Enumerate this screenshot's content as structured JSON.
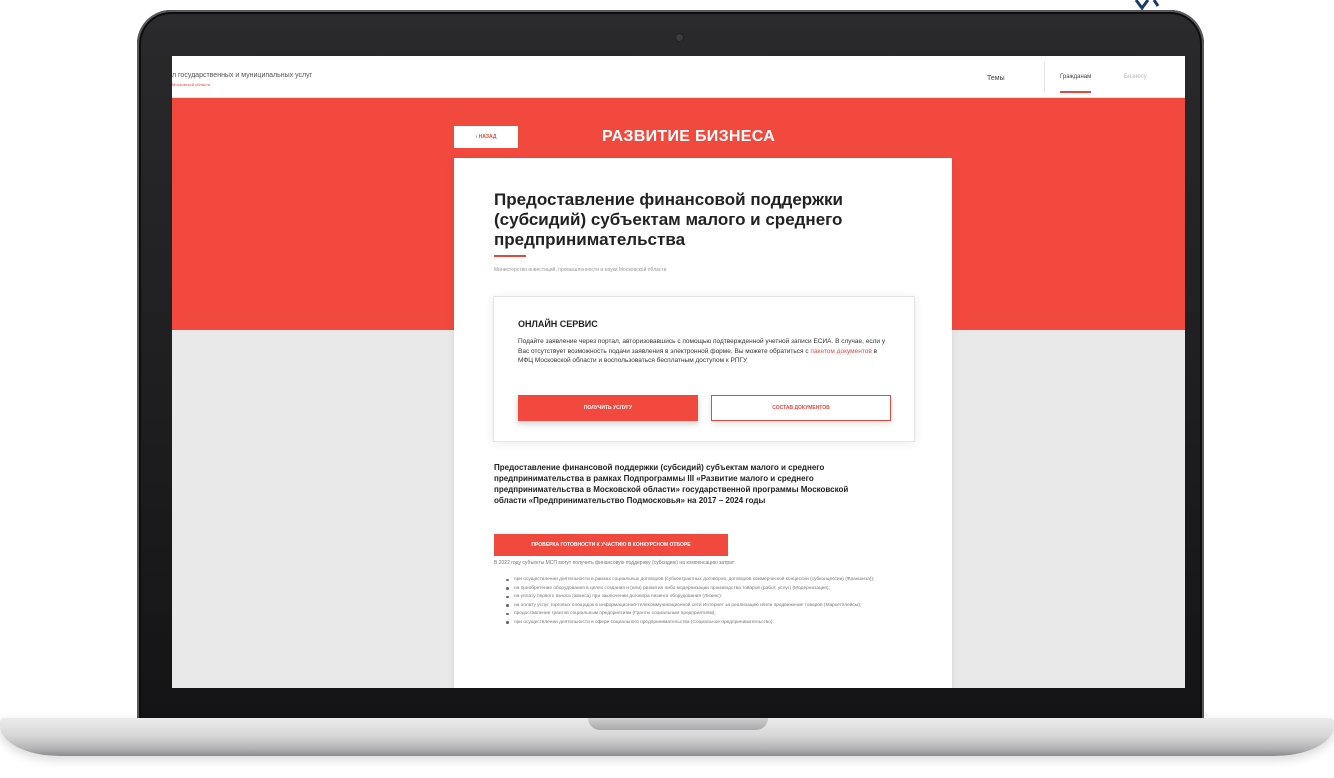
{
  "header": {
    "portal_title": "л государственных и муниципальных услуг",
    "portal_sub": "Московской области",
    "nav_topics": "Темы",
    "tab_citizens": "Гражданам",
    "tab_business": "Бизнесу"
  },
  "hero": {
    "back_label": "‹ НАЗАД",
    "title": "РАЗВИТИЕ БИЗНЕСА"
  },
  "service": {
    "title": "Предоставление финансовой поддержки (субсидий) субъектам малого и среднего предпринимательства",
    "ministry": "Министерство инвестиций, промышленности и науки Московской области"
  },
  "online": {
    "heading": "ОНЛАЙН СЕРВИС",
    "text_before": "Подайте заявление через портал, авторизовавшись с помощью подтвержденной учетной записи ЕСИА. В случае, если у Вас отсутствует возможность подачи заявления в электронной форме, Вы можете обратиться с ",
    "link": "пакетом документов",
    "text_after": " в МФЦ Московской области и воспользоваться бесплатным доступом к РПГУ",
    "get_service_label": "ПОЛУЧИТЬ УСЛУГУ",
    "docs_label": "СОСТАВ ДОКУМЕНТОВ"
  },
  "details": {
    "subprogram": "Предоставление финансовой поддержки (субсидий) субъектам малого и среднего предпринимательства в рамках Подпрограммы III «Развитие малого и среднего предпринимательства в Московской области» государственной программы Московской области «Предпринимательство Подмосковья» на 2017 – 2024 годы",
    "check_label": "ПРОВЕРКА ГОТОВНОСТИ К УЧАСТИЮ В КОНКУРСНОМ ОТБОРЕ",
    "intro": "В 2022 году субъекты МСП могут получить финансовую поддержку (субсидию) на компенсацию затрат:",
    "items": [
      "при осуществлении деятельности в рамках социальных договоров (субконтрактных договоров, договоров коммерческой концессии (субконцессии) (Франшиза));",
      "на приобретение оборудования в целях создания и (или) развития либо модернизации производства товаров (работ, услуг) (Модернизация);",
      "на уплату первого взноса (аванса) при заключении договора лизинга оборудования (Лизинг);",
      "на оплату услуг торговых площадок в информационно-телекоммуникационной сети Интернет за реализацию и/или продвижение товаров (Маркетплейсы);",
      "предоставление грантов социальным предприятиям (Гранты социальным предприятиям);",
      "при осуществлении деятельности в сфере социального предпринимательства (Социальное предпринимательство);"
    ]
  },
  "colors": {
    "brand_red": "#f2493f",
    "link_red": "#e8473d",
    "laptop_bezel": "#1a1a1c"
  }
}
